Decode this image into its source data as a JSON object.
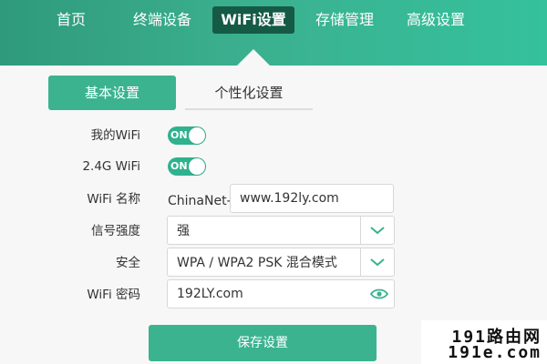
{
  "nav": {
    "items": [
      "首页",
      "终端设备",
      "WiFi设置",
      "存储管理",
      "高级设置"
    ],
    "active_index": 2
  },
  "tabs": {
    "basic": "基本设置",
    "personalize": "个性化设置"
  },
  "form": {
    "my_wifi": {
      "label": "我的WiFi",
      "toggle_text": "ON",
      "on": true
    },
    "wifi_24g": {
      "label": "2.4G WiFi",
      "toggle_text": "ON",
      "on": true
    },
    "wifi_name": {
      "label": "WiFi 名称",
      "prefix": "ChinaNet-",
      "value": "www.192ly.com"
    },
    "signal": {
      "label": "信号强度",
      "value": "强"
    },
    "security": {
      "label": "安全",
      "value": "WPA / WPA2 PSK 混合模式"
    },
    "password": {
      "label": "WiFi 密码",
      "value": "192LY.com"
    }
  },
  "save_label": "保存设置",
  "watermark": {
    "line1": "191路由网",
    "line2": "191e.com"
  },
  "colors": {
    "accent": "#3bb38e",
    "nav_active_bg": "#155a45"
  },
  "icons": {
    "select_arrow": "chevron-down-icon",
    "password_toggle": "eye-icon"
  }
}
